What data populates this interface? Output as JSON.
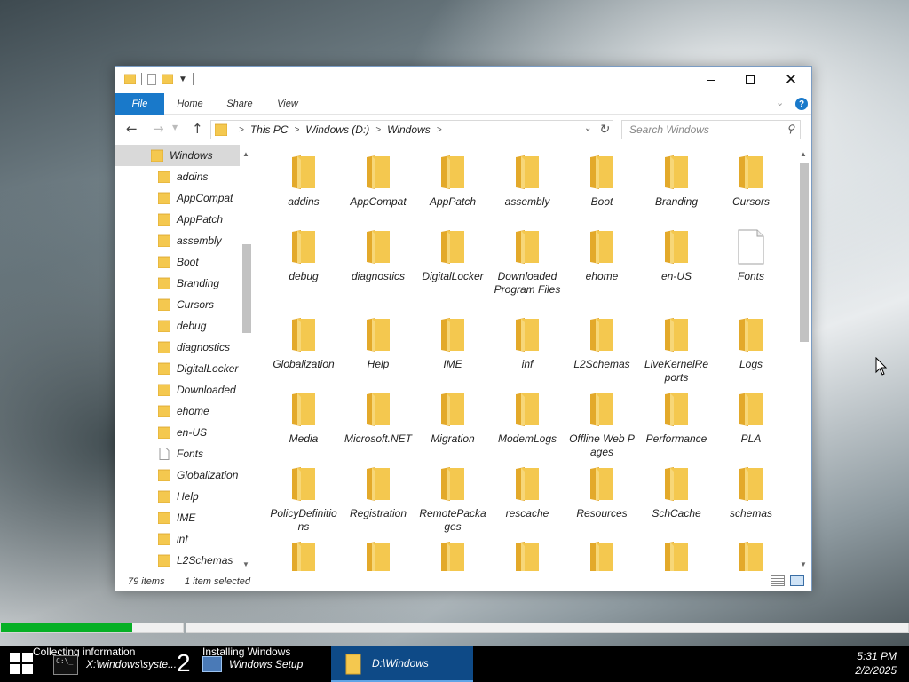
{
  "window": {
    "ribbon_tabs": {
      "file": "File",
      "home": "Home",
      "share": "Share",
      "view": "View"
    },
    "help": "?",
    "breadcrumb": [
      "This PC",
      "Windows (D:)",
      "Windows"
    ],
    "search_placeholder": "Search Windows",
    "nav_pane": {
      "selected": "Windows",
      "items": [
        {
          "label": "addins",
          "icon": "folder-icon"
        },
        {
          "label": "AppCompat",
          "icon": "folder-icon"
        },
        {
          "label": "AppPatch",
          "icon": "folder-icon"
        },
        {
          "label": "assembly",
          "icon": "folder-icon"
        },
        {
          "label": "Boot",
          "icon": "folder-icon"
        },
        {
          "label": "Branding",
          "icon": "folder-icon"
        },
        {
          "label": "Cursors",
          "icon": "folder-icon"
        },
        {
          "label": "debug",
          "icon": "folder-icon"
        },
        {
          "label": "diagnostics",
          "icon": "folder-icon"
        },
        {
          "label": "DigitalLocker",
          "icon": "folder-icon"
        },
        {
          "label": "Downloaded",
          "icon": "folder-icon"
        },
        {
          "label": "ehome",
          "icon": "folder-icon"
        },
        {
          "label": "en-US",
          "icon": "folder-icon"
        },
        {
          "label": "Fonts",
          "icon": "file-icon"
        },
        {
          "label": "Globalization",
          "icon": "folder-icon"
        },
        {
          "label": "Help",
          "icon": "folder-icon"
        },
        {
          "label": "IME",
          "icon": "folder-icon"
        },
        {
          "label": "inf",
          "icon": "folder-icon"
        },
        {
          "label": "L2Schemas",
          "icon": "folder-icon"
        }
      ]
    },
    "items": [
      {
        "label": "addins",
        "icon": "folder-icon"
      },
      {
        "label": "AppCompat",
        "icon": "folder-icon"
      },
      {
        "label": "AppPatch",
        "icon": "folder-icon"
      },
      {
        "label": "assembly",
        "icon": "folder-icon"
      },
      {
        "label": "Boot",
        "icon": "folder-icon"
      },
      {
        "label": "Branding",
        "icon": "folder-icon"
      },
      {
        "label": "Cursors",
        "icon": "folder-icon"
      },
      {
        "label": "debug",
        "icon": "folder-icon"
      },
      {
        "label": "diagnostics",
        "icon": "folder-icon"
      },
      {
        "label": "DigitalLocker",
        "icon": "folder-icon"
      },
      {
        "label": "Downloaded Program Files",
        "icon": "folder-icon"
      },
      {
        "label": "ehome",
        "icon": "folder-icon"
      },
      {
        "label": "en-US",
        "icon": "folder-icon"
      },
      {
        "label": "Fonts",
        "icon": "file-icon"
      },
      {
        "label": "Globalization",
        "icon": "folder-icon"
      },
      {
        "label": "Help",
        "icon": "folder-icon"
      },
      {
        "label": "IME",
        "icon": "folder-icon"
      },
      {
        "label": "inf",
        "icon": "folder-icon"
      },
      {
        "label": "L2Schemas",
        "icon": "folder-icon"
      },
      {
        "label": "LiveKernelReports",
        "icon": "folder-icon"
      },
      {
        "label": "Logs",
        "icon": "folder-icon"
      },
      {
        "label": "Media",
        "icon": "folder-icon"
      },
      {
        "label": "Microsoft.NET",
        "icon": "folder-icon"
      },
      {
        "label": "Migration",
        "icon": "folder-icon"
      },
      {
        "label": "ModemLogs",
        "icon": "folder-icon"
      },
      {
        "label": "Offline Web Pages",
        "icon": "folder-icon"
      },
      {
        "label": "Performance",
        "icon": "folder-icon"
      },
      {
        "label": "PLA",
        "icon": "folder-icon"
      },
      {
        "label": "PolicyDefinitions",
        "icon": "folder-icon"
      },
      {
        "label": "Registration",
        "icon": "folder-icon"
      },
      {
        "label": "RemotePackages",
        "icon": "folder-icon"
      },
      {
        "label": "rescache",
        "icon": "folder-icon"
      },
      {
        "label": "Resources",
        "icon": "folder-icon"
      },
      {
        "label": "SchCache",
        "icon": "folder-icon"
      },
      {
        "label": "schemas",
        "icon": "folder-icon"
      },
      {
        "label": "",
        "icon": "folder-icon"
      },
      {
        "label": "",
        "icon": "folder-icon"
      },
      {
        "label": "",
        "icon": "folder-icon"
      },
      {
        "label": "",
        "icon": "folder-icon"
      },
      {
        "label": "",
        "icon": "folder-icon"
      },
      {
        "label": "",
        "icon": "folder-icon"
      },
      {
        "label": "",
        "icon": "folder-icon"
      }
    ],
    "status": {
      "count": "79 items",
      "selection": "1 item selected"
    }
  },
  "setup": {
    "progress_1": 0.72,
    "progress_2": 0.0
  },
  "taskbar": {
    "step1_label": "Collecting information",
    "cmd_task": "X:\\windows\\syste...",
    "cmd_icon_text": "C:\\_",
    "step2_number": "2",
    "step2_label": "Installing Windows",
    "setup_task": "Windows Setup",
    "explorer_task": "D:\\Windows",
    "time": "5:31 PM",
    "date": "2/2/2025"
  },
  "colors": {
    "accent": "#1979ca",
    "folder": "#f4c84f",
    "folder_dark": "#e3a92a",
    "progress": "#06b025"
  }
}
